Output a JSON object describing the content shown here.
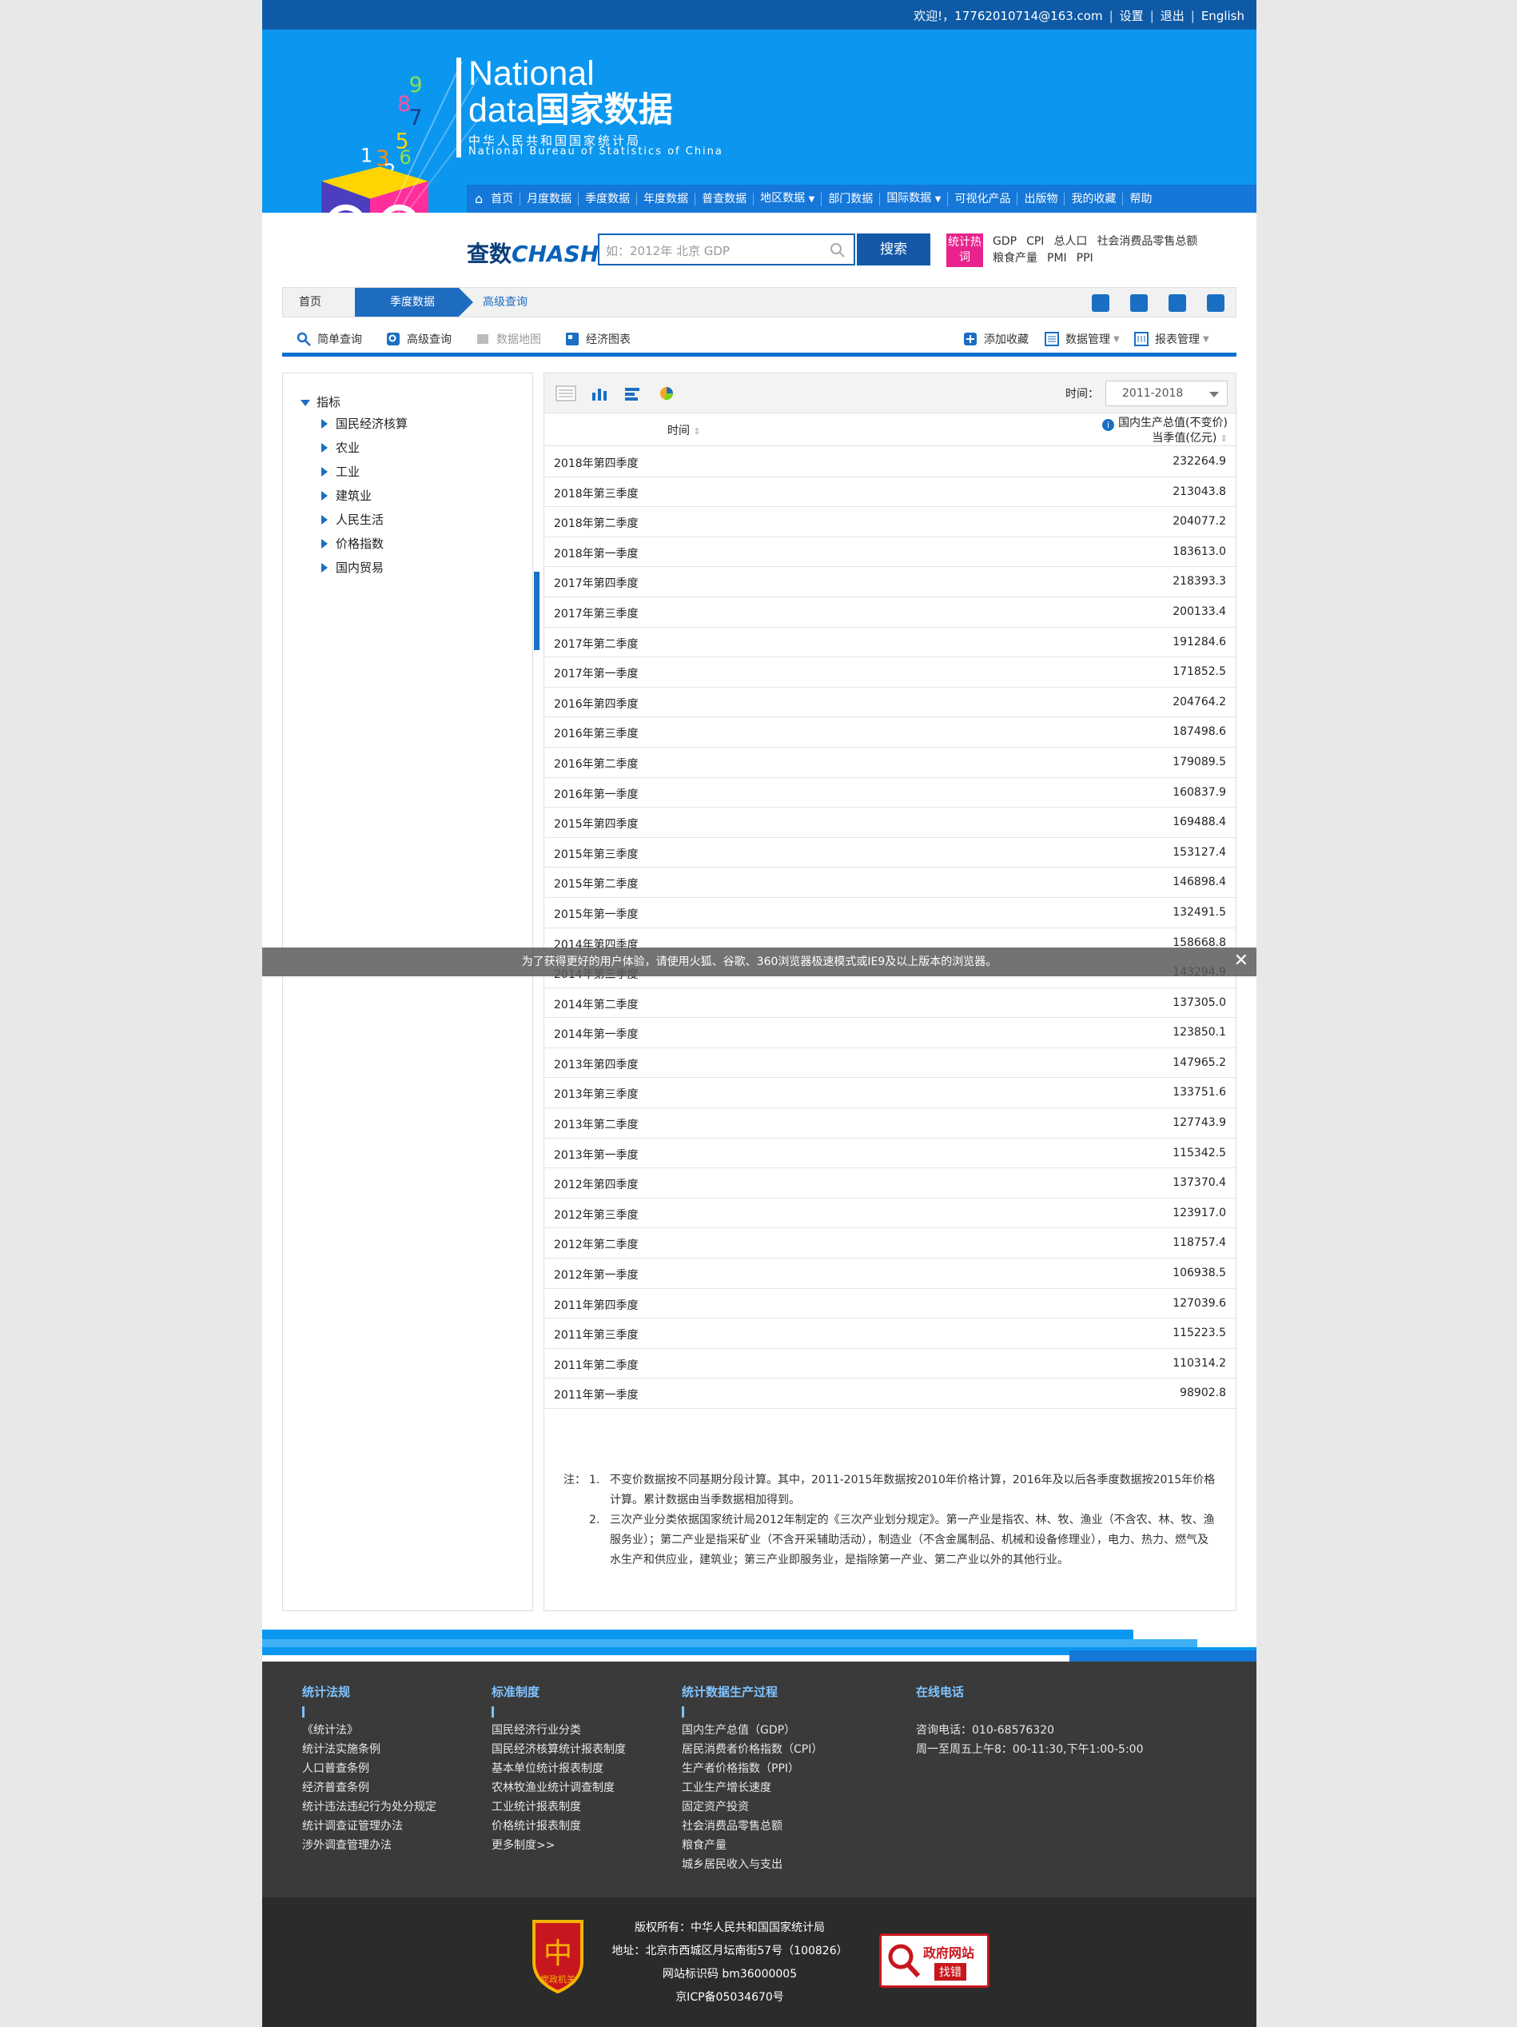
{
  "topbar": {
    "welcome": "欢迎!，17762010714@163.com",
    "settings": "设置",
    "logout": "退出",
    "lang": "English",
    "sep": "|"
  },
  "logo": {
    "line1": "National",
    "line2_en": "data",
    "line2_cn": "国家数据",
    "org_cn": "中华人民共和国国家统计局",
    "org_en": "National Bureau of Statistics of China",
    "cube_digits": "9 8 7 5 3 1 2 4 6"
  },
  "nav": [
    "首页",
    "月度数据",
    "季度数据",
    "年度数据",
    "普查数据",
    "地区数据",
    "部门数据",
    "国际数据",
    "可视化产品",
    "出版物",
    "我的收藏",
    "帮助"
  ],
  "search": {
    "brand_cn": "查数",
    "brand_en": "CHASHU",
    "placeholder": "如：2012年 北京 GDP",
    "button": "搜索",
    "hot_label": "统计热词",
    "hot_words_row1": [
      "GDP",
      "CPI",
      "总人口",
      "社会消费品零售总额"
    ],
    "hot_words_row2": [
      "粮食产量",
      "PMI",
      "PPI"
    ]
  },
  "breadcrumb": [
    "首页",
    "季度数据",
    "高级查询"
  ],
  "tools": {
    "simple": "简单查询",
    "advanced": "高级查询",
    "map": "数据地图",
    "chart": "经济图表",
    "fav": "添加收藏",
    "data_mgmt": "数据管理",
    "report_mgmt": "报表管理"
  },
  "sidebar": {
    "root": "指标",
    "items": [
      "国民经济核算",
      "农业",
      "工业",
      "建筑业",
      "人民生活",
      "价格指数",
      "国内贸易"
    ]
  },
  "table": {
    "time_label": "时间：",
    "time_range": "2011-2018",
    "col_time": "时间",
    "col_value_line1": "国内生产总值(不变价)",
    "col_value_line2": "当季值(亿元)",
    "rows": [
      [
        "2018年第四季度",
        "232264.9"
      ],
      [
        "2018年第三季度",
        "213043.8"
      ],
      [
        "2018年第二季度",
        "204077.2"
      ],
      [
        "2018年第一季度",
        "183613.0"
      ],
      [
        "2017年第四季度",
        "218393.3"
      ],
      [
        "2017年第三季度",
        "200133.4"
      ],
      [
        "2017年第二季度",
        "191284.6"
      ],
      [
        "2017年第一季度",
        "171852.5"
      ],
      [
        "2016年第四季度",
        "204764.2"
      ],
      [
        "2016年第三季度",
        "187498.6"
      ],
      [
        "2016年第二季度",
        "179089.5"
      ],
      [
        "2016年第一季度",
        "160837.9"
      ],
      [
        "2015年第四季度",
        "169488.4"
      ],
      [
        "2015年第三季度",
        "153127.4"
      ],
      [
        "2015年第二季度",
        "146898.4"
      ],
      [
        "2015年第一季度",
        "132491.5"
      ],
      [
        "2014年第四季度",
        "158668.8"
      ],
      [
        "2014年第三季度",
        "143294.9"
      ],
      [
        "2014年第二季度",
        "137305.0"
      ],
      [
        "2014年第一季度",
        "123850.1"
      ],
      [
        "2013年第四季度",
        "147965.2"
      ],
      [
        "2013年第三季度",
        "133751.6"
      ],
      [
        "2013年第二季度",
        "127743.9"
      ],
      [
        "2013年第一季度",
        "115342.5"
      ],
      [
        "2012年第四季度",
        "137370.4"
      ],
      [
        "2012年第三季度",
        "123917.0"
      ],
      [
        "2012年第二季度",
        "118757.4"
      ],
      [
        "2012年第一季度",
        "106938.5"
      ],
      [
        "2011年第四季度",
        "127039.6"
      ],
      [
        "2011年第三季度",
        "115223.5"
      ],
      [
        "2011年第二季度",
        "110314.2"
      ],
      [
        "2011年第一季度",
        "98902.8"
      ]
    ]
  },
  "notes": {
    "label": "注：",
    "n1": "1.",
    "t1": "不变价数据按不同基期分段计算。其中，2011-2015年数据按2010年价格计算，2016年及以后各季度数据按2015年价格计算。累计数据由当季数据相加得到。",
    "n2": "2.",
    "t2": "三次产业分类依据国家统计局2012年制定的《三次产业划分规定》。第一产业是指农、林、牧、渔业（不含农、林、牧、渔服务业）；第二产业是指采矿业（不含开采辅助活动），制造业（不含金属制品、机械和设备修理业），电力、热力、燃气及水生产和供应业，建筑业；第三产业即服务业，是指除第一产业、第二产业以外的其他行业。"
  },
  "alert": {
    "text": "为了获得更好的用户体验，请使用火狐、谷歌、360浏览器极速模式或IE9及以上版本的浏览器。",
    "close": "✕"
  },
  "footer": {
    "col1": {
      "title": "统计法规",
      "items": [
        "《统计法》",
        "统计法实施条例",
        "人口普查条例",
        "经济普查条例",
        "统计违法违纪行为处分规定",
        "统计调查证管理办法",
        "涉外调查管理办法"
      ]
    },
    "col2": {
      "title": "标准制度",
      "items": [
        "国民经济行业分类",
        "国民经济核算统计报表制度",
        "基本单位统计报表制度",
        "农林牧渔业统计调查制度",
        "工业统计报表制度",
        "价格统计报表制度",
        "更多制度>>"
      ]
    },
    "col3": {
      "title": "统计数据生产过程",
      "items": [
        "国内生产总值（GDP）",
        "居民消费者价格指数（CPI）",
        "生产者价格指数（PPI）",
        "工业生产增长速度",
        "固定资产投资",
        "社会消费品零售总额",
        "粮食产量",
        "城乡居民收入与支出"
      ]
    },
    "col4": {
      "title": "在线电话",
      "items": [
        "咨询电话：010-68576320",
        "周一至周五上午8：00-11:30,下午1:00-5:00"
      ]
    }
  },
  "bottom": {
    "lines": [
      "版权所有：中华人民共和国国家统计局",
      "地址：北京市西城区月坛南街57号（100826）",
      "网站标识码 bm36000005",
      "京ICP备05034670号"
    ],
    "badge_text": "党政机关",
    "gov_line1": "政府网站",
    "gov_line2": "找错"
  }
}
